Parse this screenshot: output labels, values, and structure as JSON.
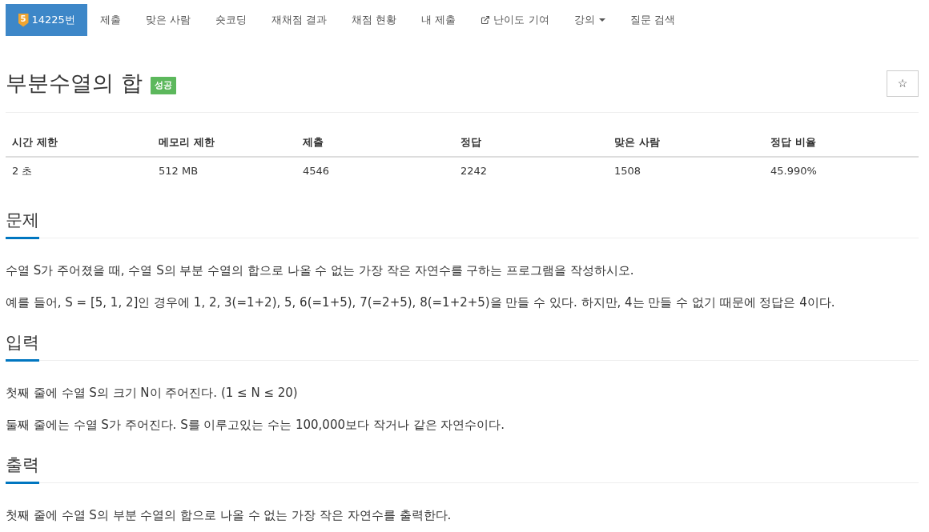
{
  "nav": {
    "items": [
      {
        "label": "14225번",
        "kind": "problem",
        "tier": "5",
        "selected": true
      },
      {
        "label": "제출",
        "kind": "link",
        "selected": false
      },
      {
        "label": "맞은 사람",
        "kind": "link",
        "selected": false
      },
      {
        "label": "숏코딩",
        "kind": "link",
        "selected": false
      },
      {
        "label": "재채점 결과",
        "kind": "link",
        "selected": false
      },
      {
        "label": "채점 현황",
        "kind": "link",
        "selected": false
      },
      {
        "label": "내 제출",
        "kind": "link",
        "selected": false
      },
      {
        "label": "난이도 기여",
        "kind": "external",
        "selected": false
      },
      {
        "label": "강의",
        "kind": "dropdown",
        "selected": false
      },
      {
        "label": "질문 검색",
        "kind": "link",
        "selected": false
      }
    ]
  },
  "problem": {
    "title": "부분수열의 합",
    "result_badge": "성공",
    "star_button": "☆"
  },
  "info_table": {
    "columns": [
      "시간 제한",
      "메모리 제한",
      "제출",
      "정답",
      "맞은 사람",
      "정답 비율"
    ],
    "rows": [
      [
        "2 초",
        "512 MB",
        "4546",
        "2242",
        "1508",
        "45.990%"
      ]
    ]
  },
  "sections": [
    {
      "heading": "문제",
      "paragraphs": [
        "수열 S가 주어졌을 때, 수열 S의 부분 수열의 합으로 나올 수 없는 가장 작은 자연수를 구하는 프로그램을 작성하시오.",
        "예를 들어, S = [5, 1, 2]인 경우에 1, 2, 3(=1+2), 5, 6(=1+5), 7(=2+5), 8(=1+2+5)을 만들 수 있다. 하지만, 4는 만들 수 없기 때문에 정답은 4이다."
      ]
    },
    {
      "heading": "입력",
      "paragraphs": [
        "첫째 줄에 수열 S의 크기 N이 주어진다. (1 ≤ N ≤ 20)",
        "둘째 줄에는 수열 S가 주어진다. S를 이루고있는 수는 100,000보다 작거나 같은 자연수이다."
      ]
    },
    {
      "heading": "출력",
      "paragraphs": [
        "첫째 줄에 수열 S의 부분 수열의 합으로 나올 수 없는 가장 작은 자연수를 출력한다."
      ]
    }
  ]
}
